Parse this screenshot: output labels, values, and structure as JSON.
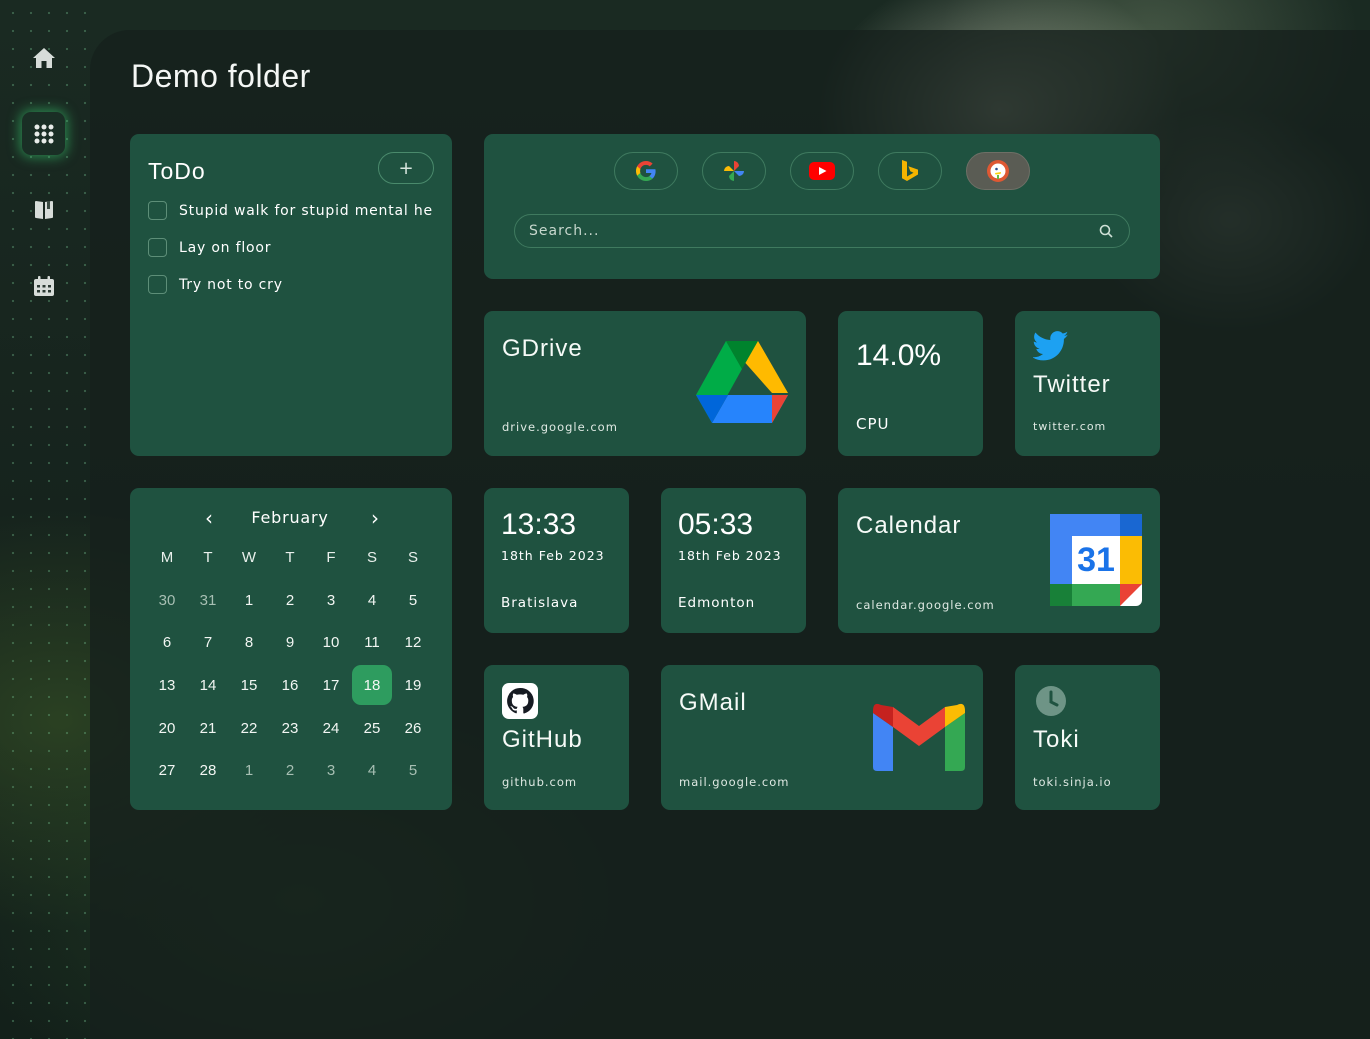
{
  "page": {
    "title": "Demo folder"
  },
  "sidebar": {
    "items": [
      {
        "name": "home",
        "icon": "home-icon"
      },
      {
        "name": "apps",
        "icon": "grid-icon",
        "active": true
      },
      {
        "name": "notes",
        "icon": "book-icon"
      },
      {
        "name": "calendar",
        "icon": "calendar-icon"
      }
    ]
  },
  "todo": {
    "title": "ToDo",
    "add_label": "+",
    "items": [
      {
        "text": "Stupid walk for stupid mental he",
        "done": false
      },
      {
        "text": "Lay on floor",
        "done": false
      },
      {
        "text": "Try not to cry",
        "done": false
      }
    ]
  },
  "search": {
    "placeholder": "Search...",
    "engines": [
      "google-icon",
      "pinwheel-icon",
      "youtube-icon",
      "bing-icon",
      "duckduckgo-icon"
    ],
    "active_engine": "duckduckgo-icon"
  },
  "gdrive": {
    "name": "GDrive",
    "url": "drive.google.com"
  },
  "cpu": {
    "value": "14.0%",
    "label": "CPU"
  },
  "twitter": {
    "name": "Twitter",
    "url": "twitter.com"
  },
  "calendar_widget": {
    "month": "February",
    "prev": "‹",
    "next": "›",
    "weekdays": [
      "M",
      "T",
      "W",
      "T",
      "F",
      "S",
      "S"
    ],
    "weeks": [
      [
        "30",
        "31",
        "1",
        "2",
        "3",
        "4",
        "5"
      ],
      [
        "6",
        "7",
        "8",
        "9",
        "10",
        "11",
        "12"
      ],
      [
        "13",
        "14",
        "15",
        "16",
        "17",
        "18",
        "19"
      ],
      [
        "20",
        "21",
        "22",
        "23",
        "24",
        "25",
        "26"
      ],
      [
        "27",
        "28",
        "1",
        "2",
        "3",
        "4",
        "5"
      ]
    ],
    "today": "18"
  },
  "clock1": {
    "time": "13:33",
    "date": "18th Feb 2023",
    "city": "Bratislava"
  },
  "clock2": {
    "time": "05:33",
    "date": "18th Feb 2023",
    "city": "Edmonton"
  },
  "gcal": {
    "name": "Calendar",
    "url": "calendar.google.com",
    "day": "31"
  },
  "github": {
    "name": "GitHub",
    "url": "github.com"
  },
  "gmail": {
    "name": "GMail",
    "url": "mail.google.com"
  },
  "toki": {
    "name": "Toki",
    "url": "toki.sinja.io"
  },
  "colors": {
    "card": "#1f5240",
    "accent": "#2e9c5f",
    "background": "#16231d"
  }
}
